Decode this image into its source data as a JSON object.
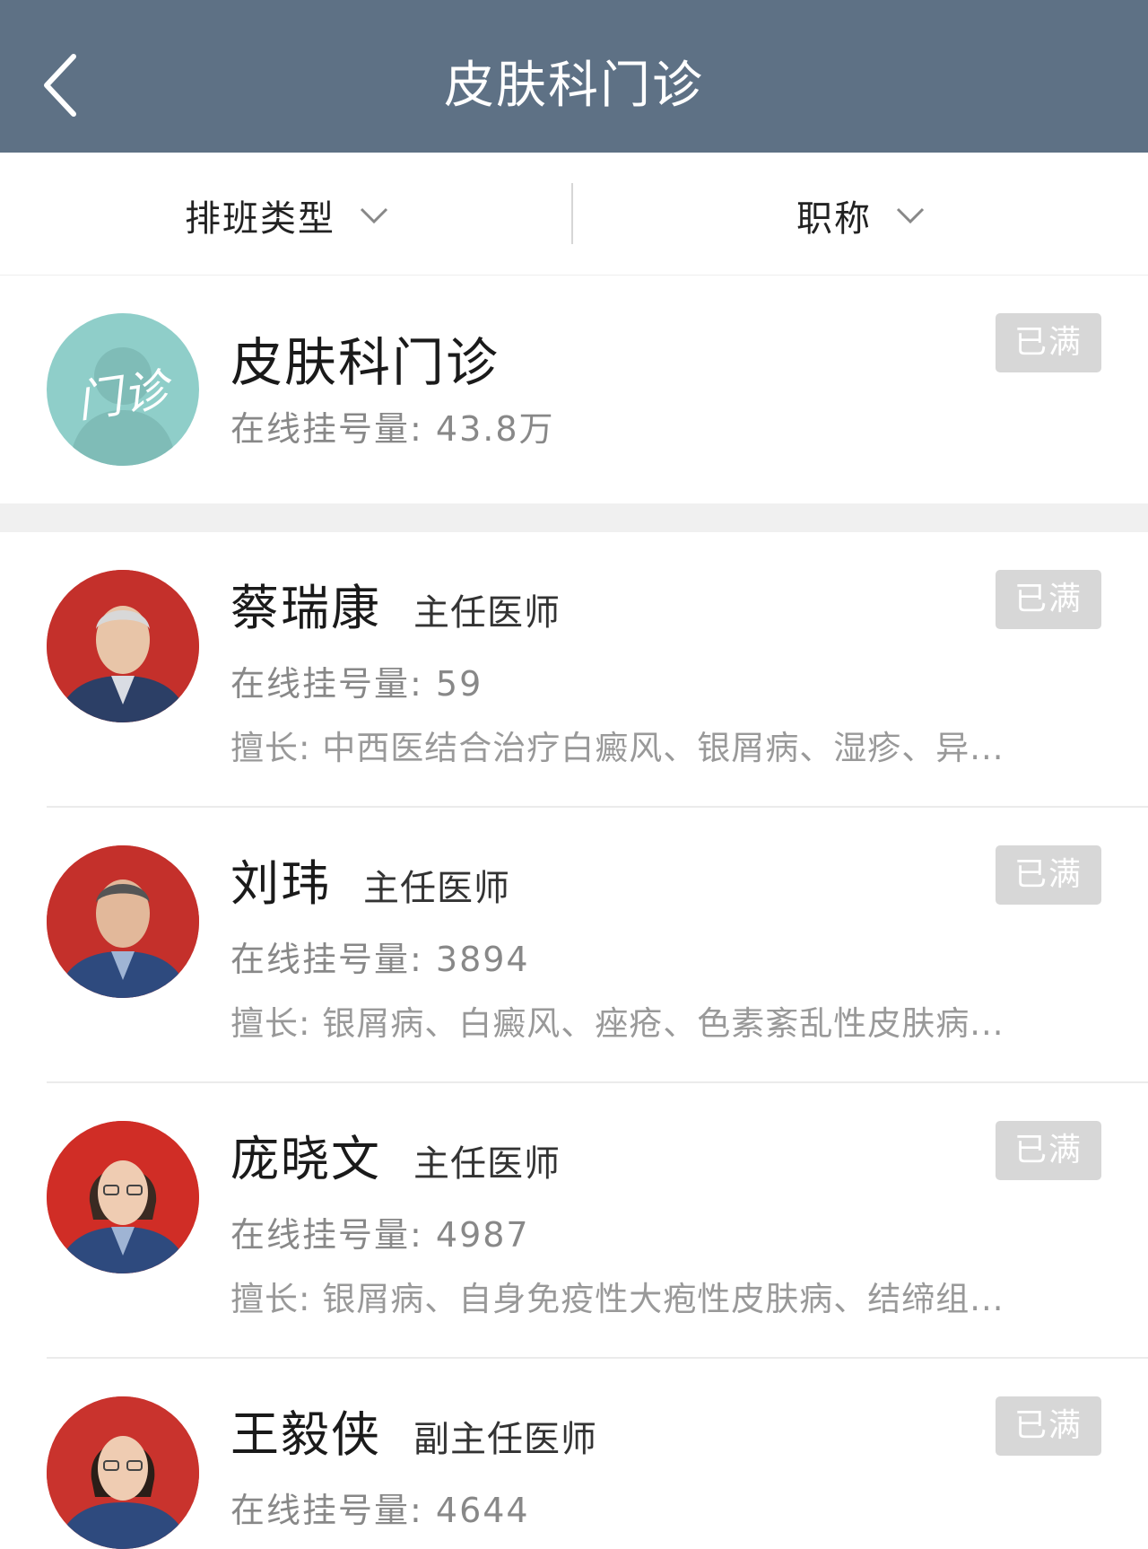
{
  "header": {
    "title": "皮肤科门诊"
  },
  "filters": {
    "schedule_type": "排班类型",
    "job_title": "职称"
  },
  "clinic": {
    "name": "皮肤科门诊",
    "avatar_text": "门诊",
    "stat_label": "在线挂号量:",
    "stat_value": "43.8万",
    "status": "已满"
  },
  "doctors": [
    {
      "name": "蔡瑞康",
      "title": "主任医师",
      "stat_label": "在线挂号量:",
      "stat_value": "59",
      "skill": "擅长: 中西医结合治疗白癜风、银屑病、湿疹、异...",
      "status": "已满"
    },
    {
      "name": "刘玮",
      "title": "主任医师",
      "stat_label": "在线挂号量:",
      "stat_value": "3894",
      "skill": "擅长: 银屑病、白癜风、痤疮、色素紊乱性皮肤病...",
      "status": "已满"
    },
    {
      "name": "庞晓文",
      "title": "主任医师",
      "stat_label": "在线挂号量:",
      "stat_value": "4987",
      "skill": "擅长: 银屑病、自身免疫性大疱性皮肤病、结缔组...",
      "status": "已满"
    },
    {
      "name": "王毅侠",
      "title": "副主任医师",
      "stat_label": "在线挂号量:",
      "stat_value": "4644",
      "skill": "",
      "status": "已满"
    }
  ]
}
